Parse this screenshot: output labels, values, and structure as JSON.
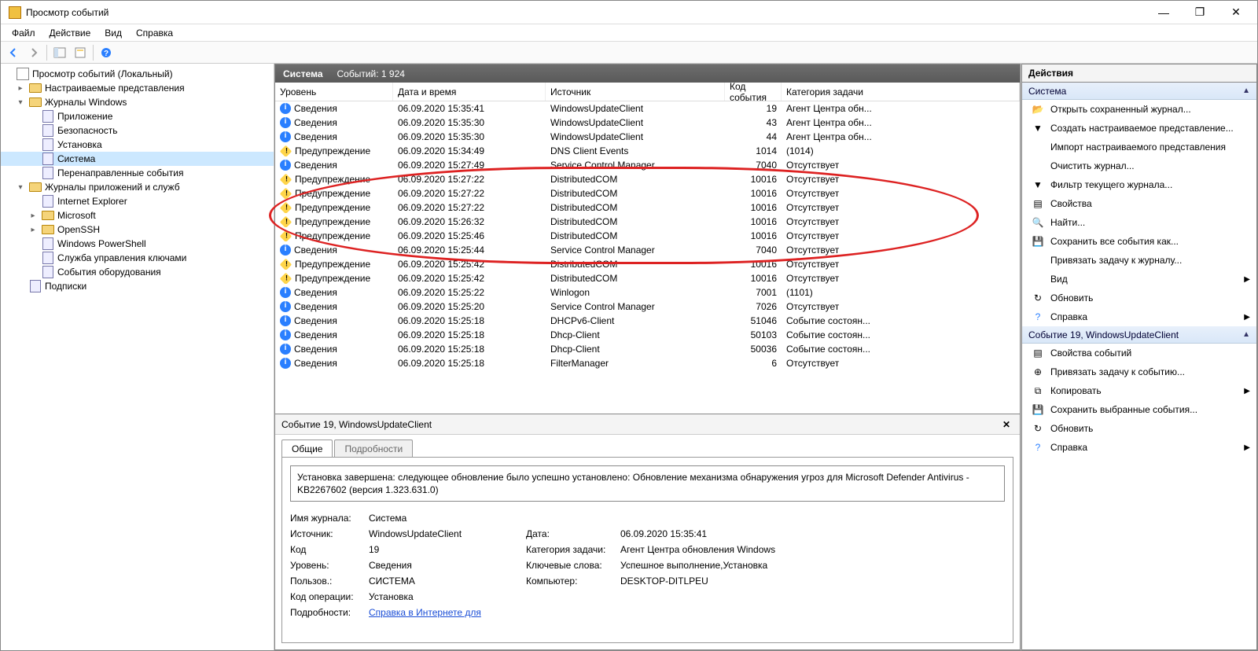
{
  "window": {
    "title": "Просмотр событий"
  },
  "menu": {
    "file": "Файл",
    "action": "Действие",
    "view": "Вид",
    "help": "Справка"
  },
  "tree": {
    "root": "Просмотр событий (Локальный)",
    "custom": "Настраиваемые представления",
    "winlogs": "Журналы Windows",
    "app": "Приложение",
    "sec": "Безопасность",
    "setup": "Установка",
    "system": "Система",
    "fwd": "Перенаправленные события",
    "appslogs": "Журналы приложений и служб",
    "ie": "Internet Explorer",
    "ms": "Microsoft",
    "ssh": "OpenSSH",
    "ps": "Windows PowerShell",
    "km": "Служба управления ключами",
    "hw": "События оборудования",
    "subs": "Подписки"
  },
  "center": {
    "title": "Система",
    "count_label": "Событий: 1 924"
  },
  "cols": {
    "level": "Уровень",
    "date": "Дата и время",
    "src": "Источник",
    "id": "Код события",
    "cat": "Категория задачи"
  },
  "lvl": {
    "info": "Сведения",
    "warn": "Предупреждение"
  },
  "rows": [
    {
      "t": "info",
      "d": "06.09.2020 15:35:41",
      "s": "WindowsUpdateClient",
      "i": "19",
      "c": "Агент Центра обн..."
    },
    {
      "t": "info",
      "d": "06.09.2020 15:35:30",
      "s": "WindowsUpdateClient",
      "i": "43",
      "c": "Агент Центра обн..."
    },
    {
      "t": "info",
      "d": "06.09.2020 15:35:30",
      "s": "WindowsUpdateClient",
      "i": "44",
      "c": "Агент Центра обн..."
    },
    {
      "t": "warn",
      "d": "06.09.2020 15:34:49",
      "s": "DNS Client Events",
      "i": "1014",
      "c": "(1014)"
    },
    {
      "t": "info",
      "d": "06.09.2020 15:27:49",
      "s": "Service Control Manager",
      "i": "7040",
      "c": "Отсутствует"
    },
    {
      "t": "warn",
      "d": "06.09.2020 15:27:22",
      "s": "DistributedCOM",
      "i": "10016",
      "c": "Отсутствует"
    },
    {
      "t": "warn",
      "d": "06.09.2020 15:27:22",
      "s": "DistributedCOM",
      "i": "10016",
      "c": "Отсутствует"
    },
    {
      "t": "warn",
      "d": "06.09.2020 15:27:22",
      "s": "DistributedCOM",
      "i": "10016",
      "c": "Отсутствует"
    },
    {
      "t": "warn",
      "d": "06.09.2020 15:26:32",
      "s": "DistributedCOM",
      "i": "10016",
      "c": "Отсутствует"
    },
    {
      "t": "warn",
      "d": "06.09.2020 15:25:46",
      "s": "DistributedCOM",
      "i": "10016",
      "c": "Отсутствует"
    },
    {
      "t": "info",
      "d": "06.09.2020 15:25:44",
      "s": "Service Control Manager",
      "i": "7040",
      "c": "Отсутствует"
    },
    {
      "t": "warn",
      "d": "06.09.2020 15:25:42",
      "s": "DistributedCOM",
      "i": "10016",
      "c": "Отсутствует"
    },
    {
      "t": "warn",
      "d": "06.09.2020 15:25:42",
      "s": "DistributedCOM",
      "i": "10016",
      "c": "Отсутствует"
    },
    {
      "t": "info",
      "d": "06.09.2020 15:25:22",
      "s": "Winlogon",
      "i": "7001",
      "c": "(1101)"
    },
    {
      "t": "info",
      "d": "06.09.2020 15:25:20",
      "s": "Service Control Manager",
      "i": "7026",
      "c": "Отсутствует"
    },
    {
      "t": "info",
      "d": "06.09.2020 15:25:18",
      "s": "DHCPv6-Client",
      "i": "51046",
      "c": "Событие состоян..."
    },
    {
      "t": "info",
      "d": "06.09.2020 15:25:18",
      "s": "Dhcp-Client",
      "i": "50103",
      "c": "Событие состоян..."
    },
    {
      "t": "info",
      "d": "06.09.2020 15:25:18",
      "s": "Dhcp-Client",
      "i": "50036",
      "c": "Событие состоян..."
    },
    {
      "t": "info",
      "d": "06.09.2020 15:25:18",
      "s": "FilterManager",
      "i": "6",
      "c": "Отсутствует"
    }
  ],
  "detail": {
    "title": "Событие 19, WindowsUpdateClient",
    "tabs": {
      "general": "Общие",
      "details": "Подробности"
    },
    "desc": "Установка завершена: следующее обновление было успешно установлено: Обновление механизма обнаружения угроз для Microsoft Defender Antivirus - KB2267602 (версия 1.323.631.0)",
    "kv": {
      "log_k": "Имя журнала:",
      "log_v": "Система",
      "src_k": "Источник:",
      "src_v": "WindowsUpdateClient",
      "date_k": "Дата:",
      "date_v": "06.09.2020 15:35:41",
      "id_k": "Код",
      "id_v": "19",
      "cat_k": "Категория задачи:",
      "cat_v": "Агент Центра обновления Windows",
      "lvl_k": "Уровень:",
      "lvl_v": "Сведения",
      "kw_k": "Ключевые слова:",
      "kw_v": "Успешное выполнение,Установка",
      "usr_k": "Пользов.:",
      "usr_v": "СИСТЕМА",
      "pc_k": "Компьютер:",
      "pc_v": "DESKTOP-DITLPEU",
      "op_k": "Код операции:",
      "op_v": "Установка",
      "more_k": "Подробности:",
      "more_link": "Справка в Интернете для"
    }
  },
  "actions": {
    "title": "Действия",
    "sec1": "Система",
    "open": "Открыть сохраненный журнал...",
    "createview": "Создать настраиваемое представление...",
    "importview": "Импорт настраиваемого представления",
    "clear": "Очистить журнал...",
    "filter": "Фильтр текущего журнала...",
    "props": "Свойства",
    "find": "Найти...",
    "saveall": "Сохранить все события как...",
    "attach": "Привязать задачу к журналу...",
    "view": "Вид",
    "refresh": "Обновить",
    "help": "Справка",
    "sec2": "Событие 19, WindowsUpdateClient",
    "evprops": "Свойства событий",
    "evattach": "Привязать задачу к событию...",
    "copy": "Копировать",
    "savesel": "Сохранить выбранные события...",
    "refresh2": "Обновить",
    "help2": "Справка"
  }
}
